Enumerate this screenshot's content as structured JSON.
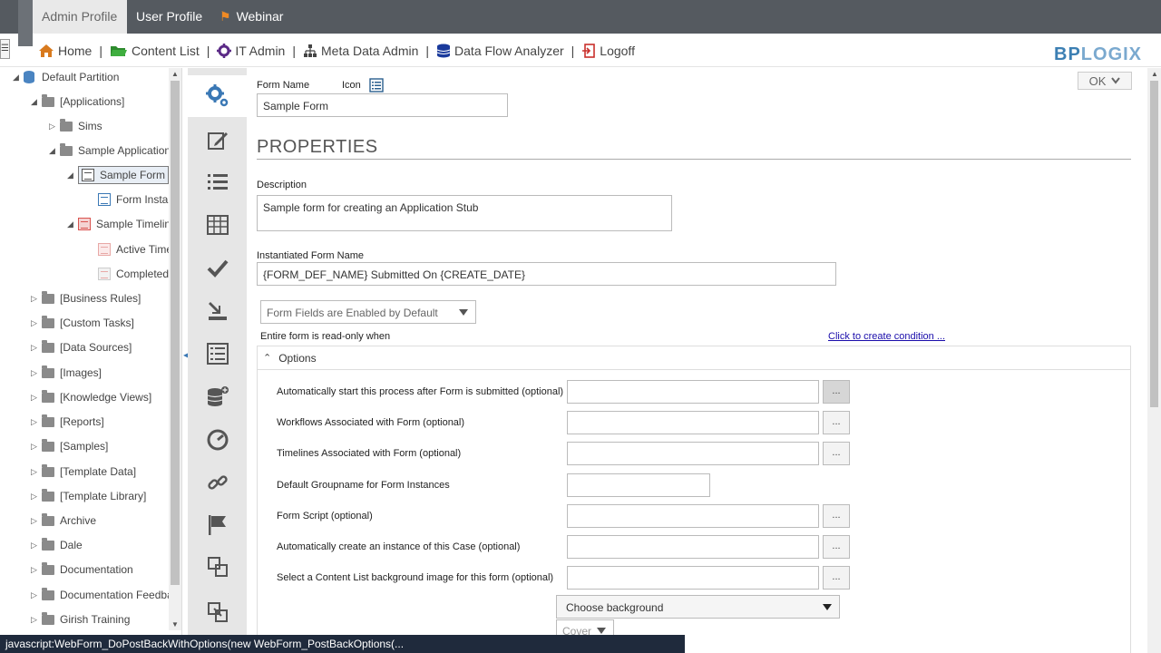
{
  "topbar": {
    "tabs": [
      {
        "label": "Admin Profile"
      },
      {
        "label": "User Profile"
      },
      {
        "label": "Webinar"
      }
    ]
  },
  "nav": {
    "items": [
      {
        "label": "Home",
        "icon": "home-icon"
      },
      {
        "label": "Content List",
        "icon": "folder-icon"
      },
      {
        "label": "IT Admin",
        "icon": "gear-icon"
      },
      {
        "label": "Meta Data Admin",
        "icon": "sitemap-icon"
      },
      {
        "label": "Data Flow Analyzer",
        "icon": "database-icon"
      },
      {
        "label": "Logoff",
        "icon": "logoff-icon"
      }
    ],
    "separator": "|"
  },
  "brand": {
    "part1": "BP",
    "part2": "LOGIX"
  },
  "tree": {
    "root": "Default Partition",
    "applications": "[Applications]",
    "sims": "Sims",
    "sample_application": "Sample Application",
    "sample_form": "Sample Form",
    "form_instances": "Form Instar",
    "sample_timeline": "Sample Timeline",
    "active_time": "Active Time",
    "completed": "Completed",
    "folders": [
      "[Business Rules]",
      "[Custom Tasks]",
      "[Data Sources]",
      "[Images]",
      "[Knowledge Views]",
      "[Reports]",
      "[Samples]",
      "[Template Data]",
      "[Template Library]",
      "Archive",
      "Dale",
      "Documentation",
      "Documentation Feedbac",
      "Girish Training"
    ]
  },
  "form": {
    "ok_label": "OK",
    "form_name_label": "Form Name",
    "icon_label": "Icon",
    "form_name_value": "Sample Form",
    "section_title": "PROPERTIES",
    "description_label": "Description",
    "description_value": "Sample form for creating an Application Stub",
    "instantiated_label": "Instantiated Form Name",
    "instantiated_value": "{FORM_DEF_NAME} Submitted On {CREATE_DATE}",
    "fields_select": "Form Fields are Enabled by Default",
    "readonly_label": "Entire form is read-only when",
    "condition_link": "Click to create condition ...",
    "options_title": "Options",
    "options": [
      {
        "label": "Automatically start this process after Form is submitted (optional)",
        "has_button": true
      },
      {
        "label": "Workflows Associated with Form (optional)",
        "has_button": true
      },
      {
        "label": "Timelines Associated with Form (optional)",
        "has_button": true
      },
      {
        "label": "Default Groupname for Form Instances",
        "has_button": false
      },
      {
        "label": "Form Script (optional)",
        "has_button": true
      },
      {
        "label": "Automatically create an instance of this Case (optional)",
        "has_button": true
      },
      {
        "label": "Select a Content List background image for this form (optional)",
        "has_button": true
      }
    ],
    "dots_label": "...",
    "background_select": "Choose background",
    "cover_select": "Cover"
  },
  "status": {
    "text": "javascript:WebForm_DoPostBackWithOptions(new WebForm_PostBackOptions(..."
  }
}
